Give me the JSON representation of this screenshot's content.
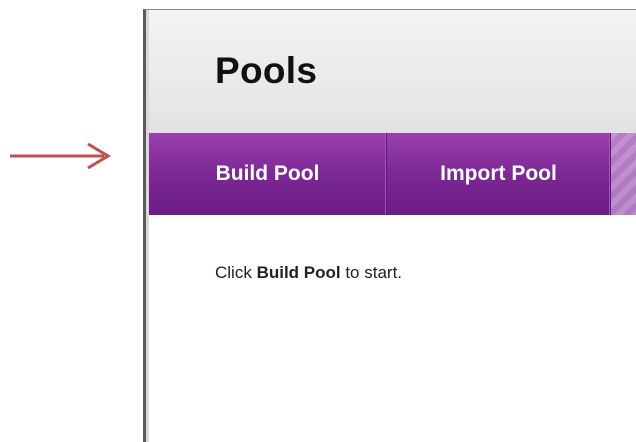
{
  "page": {
    "title": "Pools"
  },
  "action_bar": {
    "build_pool_label": "Build Pool",
    "import_pool_label": "Import Pool"
  },
  "content": {
    "instruction_prefix": "Click ",
    "instruction_emphasis": "Build Pool",
    "instruction_suffix": " to start."
  },
  "annotation": {
    "arrow_icon": "right-arrow-icon",
    "arrow_color": "#c0504d"
  },
  "colors": {
    "action_bar": "#7a2694",
    "header_bg": "#e8e8e8"
  }
}
